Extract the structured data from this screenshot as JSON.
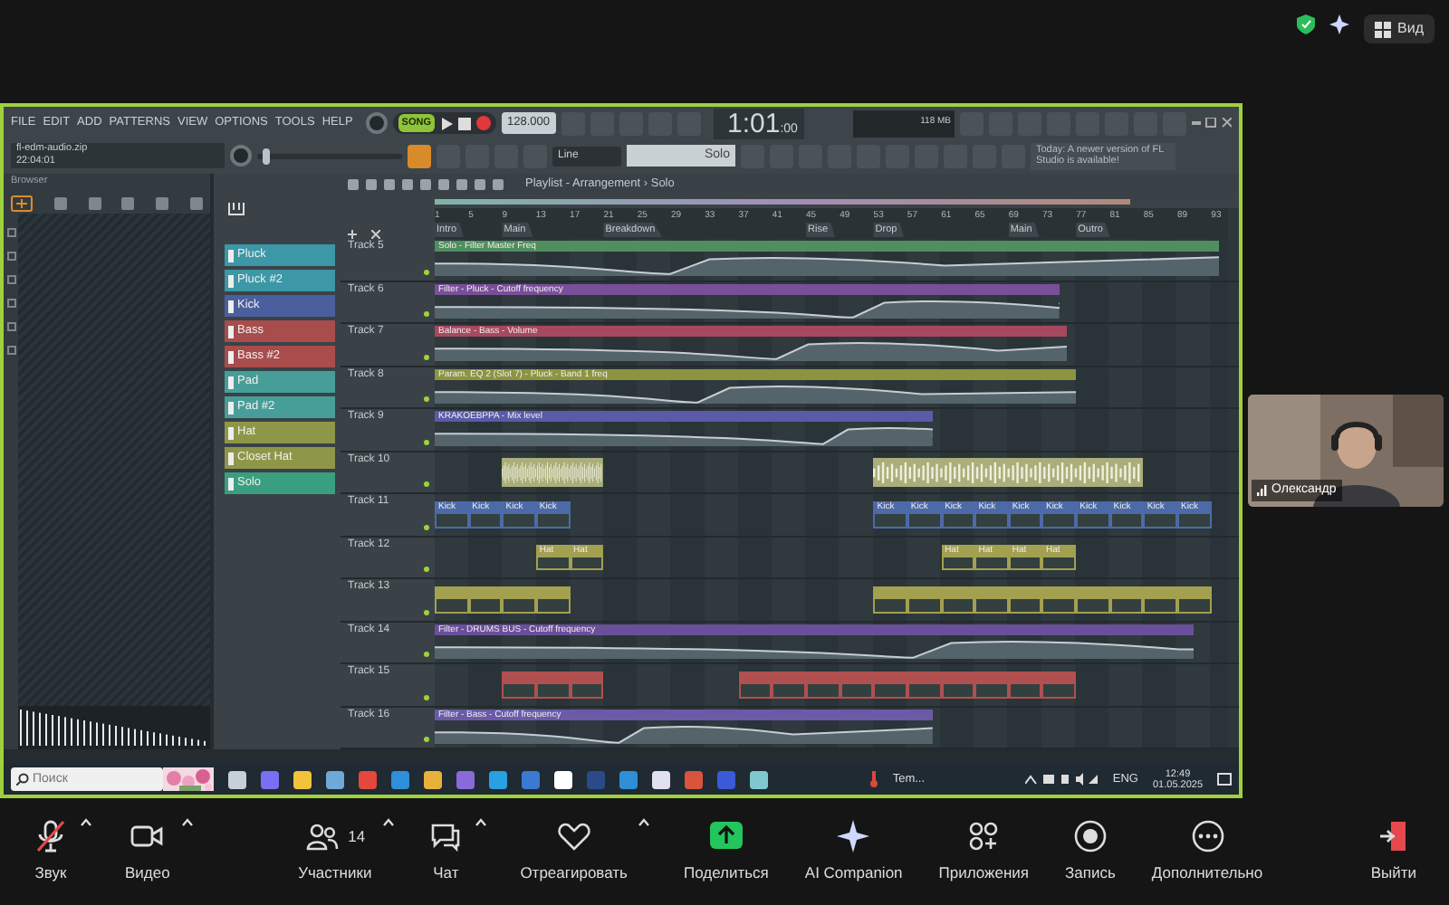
{
  "zoom": {
    "view_label": "Вид"
  },
  "fl_studio": {
    "menu": [
      "FILE",
      "EDIT",
      "ADD",
      "PATTERNS",
      "VIEW",
      "OPTIONS",
      "TOOLS",
      "HELP"
    ],
    "song_mode": "SONG",
    "tempo": "128.000",
    "time": "1:01",
    "time_sub": ":00",
    "memory": "118 MB",
    "project_file": "fl-edm-audio.zip",
    "project_time": "22:04:01",
    "master_volume": {
      "level": 0.04
    },
    "snap": "Line",
    "pattern": "Solo",
    "notice": "Today: A newer version of FL Studio is available!",
    "browser_title": "Browser",
    "playlist_title": "Playlist - Arrangement › Solo",
    "channels": [
      {
        "label": "Pluck",
        "color": "#3c97a6"
      },
      {
        "label": "Pluck #2",
        "color": "#3c97a6"
      },
      {
        "label": "Kick",
        "color": "#4b5f9e"
      },
      {
        "label": "Bass",
        "color": "#a84c4c"
      },
      {
        "label": "Bass #2",
        "color": "#a84c4c"
      },
      {
        "label": "Pad",
        "color": "#479e98"
      },
      {
        "label": "Pad #2",
        "color": "#479e98"
      },
      {
        "label": "Hat",
        "color": "#8e9747"
      },
      {
        "label": "Closet Hat",
        "color": "#8e9747"
      },
      {
        "label": "Solo",
        "color": "#3a9f7e"
      }
    ],
    "ruler": [
      "1",
      "5",
      "9",
      "13",
      "17",
      "21",
      "25",
      "29",
      "33",
      "37",
      "41",
      "45",
      "49",
      "53",
      "57",
      "61",
      "65",
      "69",
      "73",
      "77",
      "81",
      "85",
      "89",
      "93"
    ],
    "markers": [
      "Intro",
      "Main",
      "Breakdown",
      "Rise",
      "Drop",
      "Main",
      "Outro"
    ],
    "tracks": [
      {
        "label": "Track 5",
        "kind": "automation",
        "color": "#4f8f5e",
        "clips": [
          "Solo - Filter Master Freq"
        ]
      },
      {
        "label": "Track 6",
        "kind": "automation",
        "color": "#7a4f9a",
        "clips": [
          "Filter - Pluck - Cutoff frequency"
        ]
      },
      {
        "label": "Track 7",
        "kind": "automation",
        "color": "#a8485f",
        "clips": [
          "Balance - Bass - Volume"
        ]
      },
      {
        "label": "Track 8",
        "kind": "automation",
        "color": "#8c9440",
        "clips": [
          "Param. EQ 2 (Slot 7) - Pluck - Band 1 freq"
        ]
      },
      {
        "label": "Track 9",
        "kind": "automation",
        "color": "#5a5aa8",
        "clips": [
          "KRAKOEBPPA - Mix level"
        ]
      },
      {
        "label": "Track 10",
        "kind": "audio",
        "color": "#a9ae7a"
      },
      {
        "label": "Track 11",
        "kind": "pattern",
        "color": "#4d6aa8",
        "clips": [
          "Kick",
          "Kick",
          "Kick",
          "Kick",
          "Kick",
          "Kick",
          "Kick",
          "Kick",
          "Kick",
          "Kick",
          "Kick",
          "Kick",
          "Kick",
          "Kick"
        ]
      },
      {
        "label": "Track 12",
        "kind": "pattern",
        "color": "#a3a050",
        "clips": [
          "Hat",
          "Hat",
          "Hat",
          "Hat",
          "Hat",
          "Hat"
        ]
      },
      {
        "label": "Track 13",
        "kind": "pattern",
        "color": "#a3a050"
      },
      {
        "label": "Track 14",
        "kind": "automation",
        "color": "#6a4f9a",
        "clips": [
          "Filter - DRUMS BUS - Cutoff frequency"
        ]
      },
      {
        "label": "Track 15",
        "kind": "pattern",
        "color": "#b05050"
      },
      {
        "label": "Track 16",
        "kind": "automation",
        "color": "#6a5aa8",
        "clips": [
          "Filter - Bass - Cutoff frequency"
        ]
      }
    ]
  },
  "taskbar": {
    "search_placeholder": "Поиск",
    "weather": "Tem...",
    "language": "ENG",
    "time": "12:49",
    "date": "01.05.2025"
  },
  "participant": {
    "name": "Олександр"
  },
  "toolbar": [
    {
      "kind": "mic",
      "label": "Звук",
      "muted": true,
      "menu": true
    },
    {
      "kind": "video",
      "label": "Видео",
      "menu": true
    },
    {
      "kind": "participants",
      "label": "Участники",
      "count": "14",
      "menu": true
    },
    {
      "kind": "chat",
      "label": "Чат",
      "menu": true
    },
    {
      "kind": "react",
      "label": "Отреагировать",
      "menu": true
    },
    {
      "kind": "share",
      "label": "Поделиться"
    },
    {
      "kind": "ai",
      "label": "AI Companion"
    },
    {
      "kind": "apps",
      "label": "Приложения"
    },
    {
      "kind": "record",
      "label": "Запись"
    },
    {
      "kind": "more",
      "label": "Дополнительно"
    },
    {
      "kind": "leave",
      "label": "Выйти"
    }
  ]
}
